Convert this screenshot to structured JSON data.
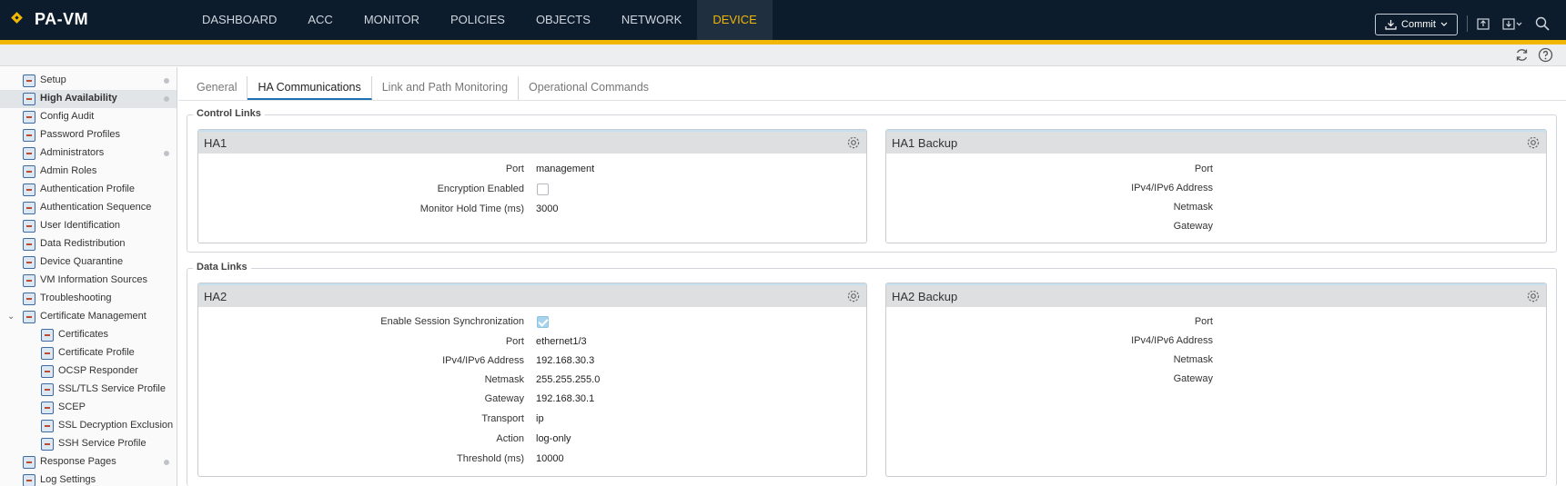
{
  "app": {
    "name": "PA-VM"
  },
  "nav": [
    {
      "label": "DASHBOARD",
      "active": false
    },
    {
      "label": "ACC",
      "active": false
    },
    {
      "label": "MONITOR",
      "active": false
    },
    {
      "label": "POLICIES",
      "active": false
    },
    {
      "label": "OBJECTS",
      "active": false
    },
    {
      "label": "NETWORK",
      "active": false
    },
    {
      "label": "DEVICE",
      "active": true
    }
  ],
  "header": {
    "commit_label": "Commit"
  },
  "colors": {
    "header_bg": "#0c1c2c",
    "accent": "#f2b705",
    "active_tab_underline": "#1f6fb5"
  },
  "sidebar": {
    "items": [
      {
        "label": "Setup",
        "indent": 0,
        "dot": true
      },
      {
        "label": "High Availability",
        "indent": 0,
        "dot": true,
        "active": true
      },
      {
        "label": "Config Audit",
        "indent": 0
      },
      {
        "label": "Password Profiles",
        "indent": 0
      },
      {
        "label": "Administrators",
        "indent": 0,
        "dot": true
      },
      {
        "label": "Admin Roles",
        "indent": 0
      },
      {
        "label": "Authentication Profile",
        "indent": 0
      },
      {
        "label": "Authentication Sequence",
        "indent": 0
      },
      {
        "label": "User Identification",
        "indent": 0
      },
      {
        "label": "Data Redistribution",
        "indent": 0
      },
      {
        "label": "Device Quarantine",
        "indent": 0
      },
      {
        "label": "VM Information Sources",
        "indent": 0
      },
      {
        "label": "Troubleshooting",
        "indent": 0
      },
      {
        "label": "Certificate Management",
        "indent": 0,
        "expanded": true
      },
      {
        "label": "Certificates",
        "indent": 1
      },
      {
        "label": "Certificate Profile",
        "indent": 1
      },
      {
        "label": "OCSP Responder",
        "indent": 1
      },
      {
        "label": "SSL/TLS Service Profile",
        "indent": 1
      },
      {
        "label": "SCEP",
        "indent": 1
      },
      {
        "label": "SSL Decryption Exclusion",
        "indent": 1
      },
      {
        "label": "SSH Service Profile",
        "indent": 1
      },
      {
        "label": "Response Pages",
        "indent": 0,
        "dot": true
      },
      {
        "label": "Log Settings",
        "indent": 0
      }
    ]
  },
  "tabs": [
    {
      "label": "General",
      "active": false
    },
    {
      "label": "HA Communications",
      "active": true
    },
    {
      "label": "Link and Path Monitoring",
      "active": false
    },
    {
      "label": "Operational Commands",
      "active": false
    }
  ],
  "control_links": {
    "title": "Control Links",
    "ha1": {
      "title": "HA1",
      "port_label": "Port",
      "port_value": "management",
      "encryption_label": "Encryption Enabled",
      "encryption_checked": false,
      "hold_label": "Monitor Hold Time (ms)",
      "hold_value": "3000"
    },
    "ha1_backup": {
      "title": "HA1 Backup",
      "port_label": "Port",
      "ip_label": "IPv4/IPv6 Address",
      "netmask_label": "Netmask",
      "gateway_label": "Gateway"
    }
  },
  "data_links": {
    "title": "Data Links",
    "ha2": {
      "title": "HA2",
      "sync_label": "Enable Session Synchronization",
      "sync_checked": true,
      "port_label": "Port",
      "port_value": "ethernet1/3",
      "ip_label": "IPv4/IPv6 Address",
      "ip_value": "192.168.30.3",
      "netmask_label": "Netmask",
      "netmask_value": "255.255.255.0",
      "gateway_label": "Gateway",
      "gateway_value": "192.168.30.1",
      "transport_label": "Transport",
      "transport_value": "ip",
      "action_label": "Action",
      "action_value": "log-only",
      "threshold_label": "Threshold (ms)",
      "threshold_value": "10000"
    },
    "ha2_backup": {
      "title": "HA2 Backup",
      "port_label": "Port",
      "ip_label": "IPv4/IPv6 Address",
      "netmask_label": "Netmask",
      "gateway_label": "Gateway"
    }
  }
}
